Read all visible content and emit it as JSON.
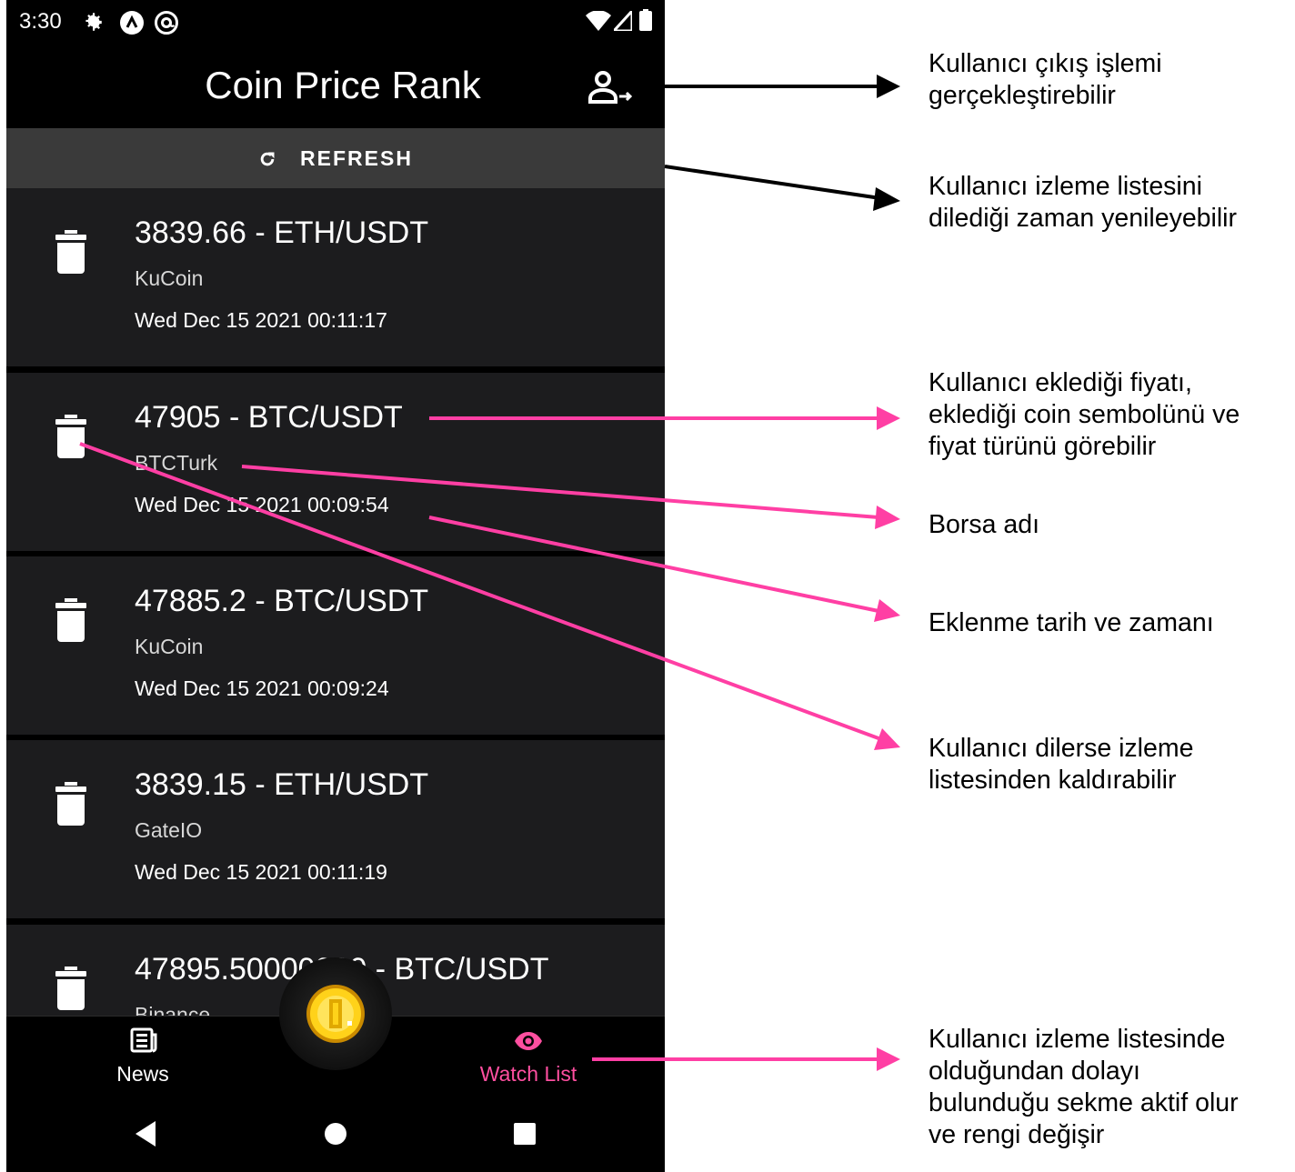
{
  "status_bar": {
    "time": "3:30",
    "left_icons": [
      "settings-icon",
      "app-a-icon",
      "app-at-icon"
    ],
    "right_icons": [
      "wifi-icon",
      "signal-icon",
      "battery-icon"
    ]
  },
  "app_bar": {
    "title": "Coin Price Rank",
    "logout_icon": "person-logout-icon"
  },
  "refresh": {
    "label": "REFRESH",
    "icon": "refresh-icon"
  },
  "watchlist": [
    {
      "title": "3839.66 - ETH/USDT",
      "exchange": "KuCoin",
      "date": "Wed Dec 15 2021 00:11:17"
    },
    {
      "title": "47905 - BTC/USDT",
      "exchange": "BTCTurk",
      "date": "Wed Dec 15 2021 00:09:54"
    },
    {
      "title": "47885.2 - BTC/USDT",
      "exchange": "KuCoin",
      "date": "Wed Dec 15 2021 00:09:24"
    },
    {
      "title": "3839.15 - ETH/USDT",
      "exchange": "GateIO",
      "date": "Wed Dec 15 2021 00:11:19"
    },
    {
      "title": "47895.50000000 - BTC/USDT",
      "exchange": "Binance",
      "date": ""
    }
  ],
  "bottom_nav": {
    "news_label": "News",
    "watch_label": "Watch List",
    "active_tab": "Watch List",
    "active_color": "#ff4fa0"
  },
  "annotations": [
    {
      "lines": [
        "Kullanıcı çıkış işlemi",
        "gerçekleştirebilir"
      ],
      "arrow_color": "#000000"
    },
    {
      "lines": [
        "Kullanıcı izleme listesini",
        "dilediği zaman yenileyebilir"
      ],
      "arrow_color": "#000000"
    },
    {
      "lines": [
        "Kullanıcı eklediği fiyatı,",
        "eklediği coin sembolünü ve",
        "fiyat türünü görebilir"
      ],
      "arrow_color": "#ff3fa4"
    },
    {
      "lines": [
        "Borsa adı"
      ],
      "arrow_color": "#ff3fa4"
    },
    {
      "lines": [
        "Eklenme tarih ve zamanı"
      ],
      "arrow_color": "#ff3fa4"
    },
    {
      "lines": [
        "Kullanıcı dilerse izleme",
        "listesinden kaldırabilir"
      ],
      "arrow_color": "#ff3fa4"
    },
    {
      "lines": [
        "Kullanıcı izleme listesinde",
        "olduğundan dolayı",
        "bulunduğu sekme aktif olur",
        "ve rengi değişir"
      ],
      "arrow_color": "#ff3fa4"
    }
  ]
}
